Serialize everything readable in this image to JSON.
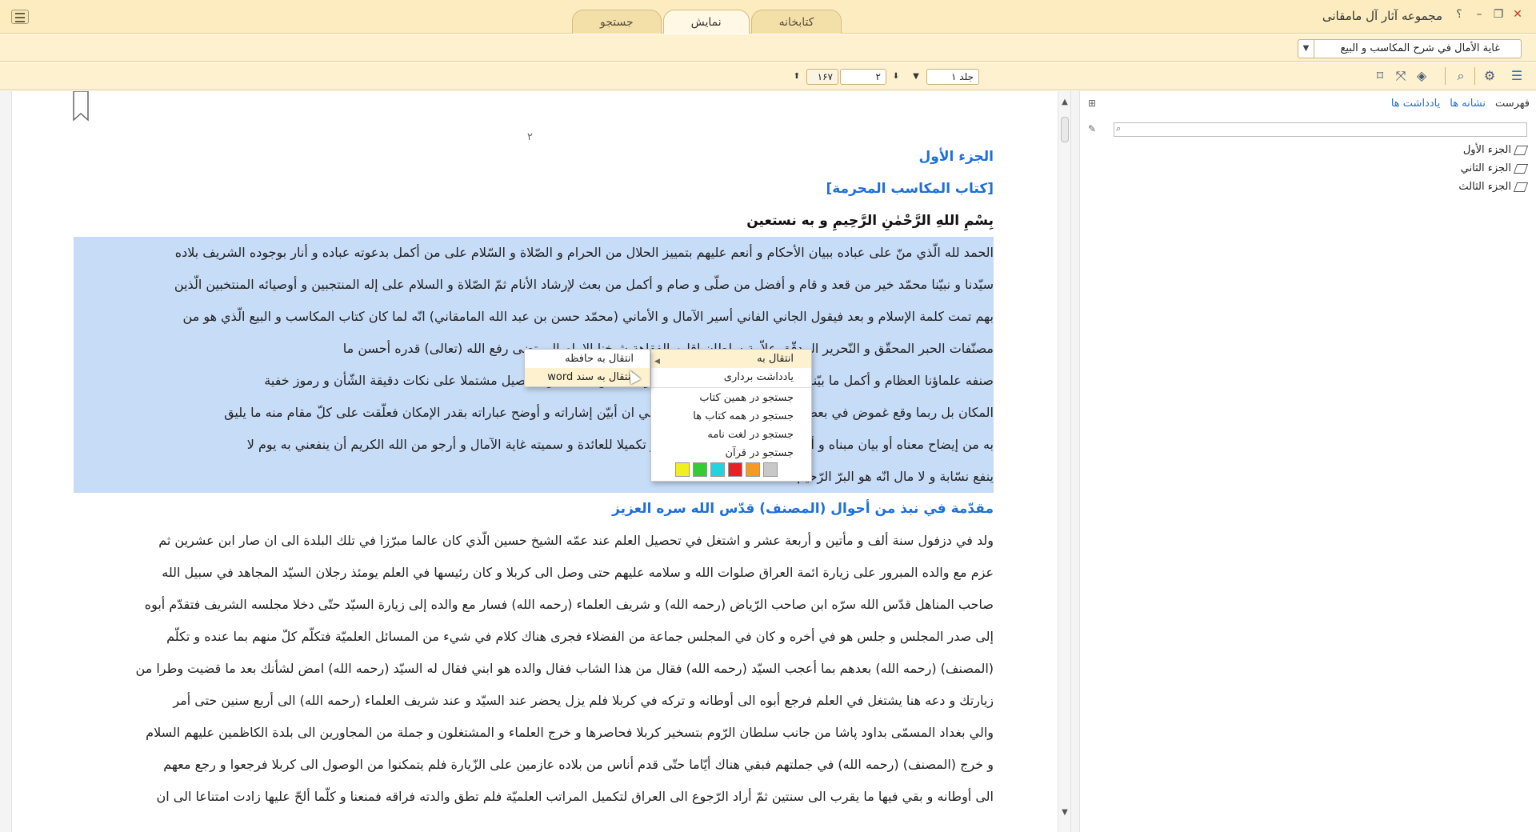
{
  "titlebar": {
    "app_title": "مجموعه آثار آل مامقانی",
    "tabs": [
      {
        "label": "جستجو",
        "active": false
      },
      {
        "label": "نمایش",
        "active": true
      },
      {
        "label": "کتابخانه",
        "active": false
      }
    ],
    "help_glyph": "؟",
    "minimize_glyph": "–",
    "restore_glyph": "❐",
    "close_glyph": "✕"
  },
  "addressbar": {
    "book": "غاية الأمال في شرح المكاسب و البيع",
    "dropdown_glyph": "▼"
  },
  "toolbar": {
    "volume": "جلد ۱",
    "page": "۲",
    "total_pages": "۱۶۷",
    "dropdown_glyph": "▼",
    "prev_glyph": "⬆",
    "next_glyph": "⬇",
    "icons": [
      "list-icon",
      "settings-icon",
      "search-icon",
      "layers-icon",
      "fullscreen-icon",
      "bookmark-icon"
    ]
  },
  "reader": {
    "page_number": "۲",
    "headings": {
      "part": "الجزء الأول",
      "book": "[كتاب المكاسب المحرمة]",
      "bismillah": "بِسْمِ اللهِ الرَّحْمٰنِ الرَّحِيمِ و به نستعين"
    },
    "selected_lines": [
      "الحمد لله الّذي منّ على عباده ببيان الأحكام و أنعم عليهم بتمييز الحلال من الحرام و الصّلاة و السّلام على من أكمل بدعوته عباده و أنار بوجوده الشريف بلاده",
      "سيّدنا و نبيّنا محمّد خير من قعد و قام و أفضل من صلّى و صام و أكمل من بعث لإرشاد الأنام ثمّ الصّلاة و السلام على إله المنتجبين و أوصيائه المنتخبين الّذين",
      "بهم تمت كلمة الإسلام و بعد فيقول الجاني الفاني أسير الآمال و الأماني (محمّد حسن بن عبد الله المامقاني) انّه لما كان كتاب المكاسب و البيع الّذي هو من",
      "مصنّفات الحبر المحقّق و النّحرير المدقّق علاّمة سلطان إقليم الفقاهة شيخنا الامام المرتضى رفع الله (تعالى) قدره أحسن ما",
      "صنفه علماؤنا العظام و أكمل ما بيّنوا فيه المقام و قد كان مع ما هو عليه من البسط و التفصيل مشتملا على نكات دقيقة الشّأن و رموز خفية",
      "المكان بل ربما وقع غموض في بعض عباراته بمجرّد الإشارة سنح لي ان أبيّن إشاراته و أوضح عباراته بقدر الإمكان فعلّقت على كلّ مقام منه ما يليق",
      "به من إيضاح معناه أو بيان مبناه و أضفت الى ذلك تتميما للفائدة و تكميلا للعائدة و سميته غاية الآمال و أرجو من الله الكريم أن ينفعني به يوم لا",
      "ينفع نسّابة و لا مال انّه هو البرّ الرّحيم"
    ],
    "section_heading": "مقدّمة في نبذ من أحوال (المصنف) قدّس الله سره العزيز",
    "body_lines": [
      "ولد في دزفول سنة ألف و مأتين و أربعة عشر و اشتغل في تحصيل العلم عند عمّه الشيخ حسين الّذي كان عالما مبرّزا في تلك البلدة الى ان صار ابن عشرين ثم",
      "عزم مع والده المبرور على زيارة ائمة العراق صلوات الله و سلامه عليهم حتى وصل الى كربلا و كان رئيسها في العلم يومئذ رجلان السيّد المجاهد في سبيل الله",
      "صاحب المناهل قدّس الله سرّه ابن صاحب الرّياض (رحمه الله) و شريف العلماء (رحمه الله) فسار مع والده إلى زيارة السيّد حتّى دخلا مجلسه الشريف فتقدّم أبوه",
      "إلى صدر المجلس و جلس هو في أخره و كان في المجلس جماعة من الفضلاء فجرى هناك كلام في شيء من المسائل العلميّة فتكلّم كلّ منهم بما عنده و تكلّم",
      "(المصنف) (رحمه الله) بعدهم بما أعجب السيّد (رحمه الله) فقال من هذا الشاب فقال والده هو ابني فقال له السيّد (رحمه الله) امض لشأنك بعد ما قضيت وطرا من",
      "زيارتك و دعه هنا يشتغل في العلم فرجع أبوه الى أوطانه و تركه في كربلا فلم يزل يحضر عند السيّد و عند شريف العلماء (رحمه الله) الى أربع سنين حتى أمر",
      "والي بغداد المسمّى بداود پاشا من جانب سلطان الرّوم بتسخير كربلا فحاصرها و خرج العلماء و المشتغلون و جملة من المجاورين الى بلدة الكاظمين عليهم السلام",
      "و خرج (المصنف) (رحمه الله) في جملتهم فبقي هناك أيّاما حتّى قدم أناس من بلاده عازمين على الزّيارة فلم يتمكنوا من الوصول الى كربلا فرجعوا و رجع معهم",
      "الى أوطانه و بقي فيها ما يقرب الى سنتين ثمّ أراد الرّجوع الى العراق لتكميل المراتب العلميّة فلم تطق والدته فراقه فمنعنا و كلّما ألحّ عليها زادت امتناعا الى ان"
    ]
  },
  "context_menu": {
    "goto": "انتقال به",
    "note": "یادداشت برداری",
    "search_this_book": "جستجو در همین کتاب",
    "search_all_books": "جستجو در همه کتاب ها",
    "search_dictionary": "جستجو در لغت نامه",
    "search_quran": "جستجو در قرآن",
    "colors": [
      "#f0f020",
      "#33cc33",
      "#22d3e0",
      "#e82222",
      "#f59a22",
      "#c8c8c8"
    ]
  },
  "submenu": {
    "to_clipboard": "انتقال به حافظه",
    "to_word": "انتقال به سند word"
  },
  "sidebar": {
    "tabs": [
      "فهرست",
      "نشانه ها",
      "یادداشت ها"
    ],
    "tree": [
      "الجزء الأول",
      "الجزء الثاني",
      "الجزء الثالث"
    ]
  }
}
